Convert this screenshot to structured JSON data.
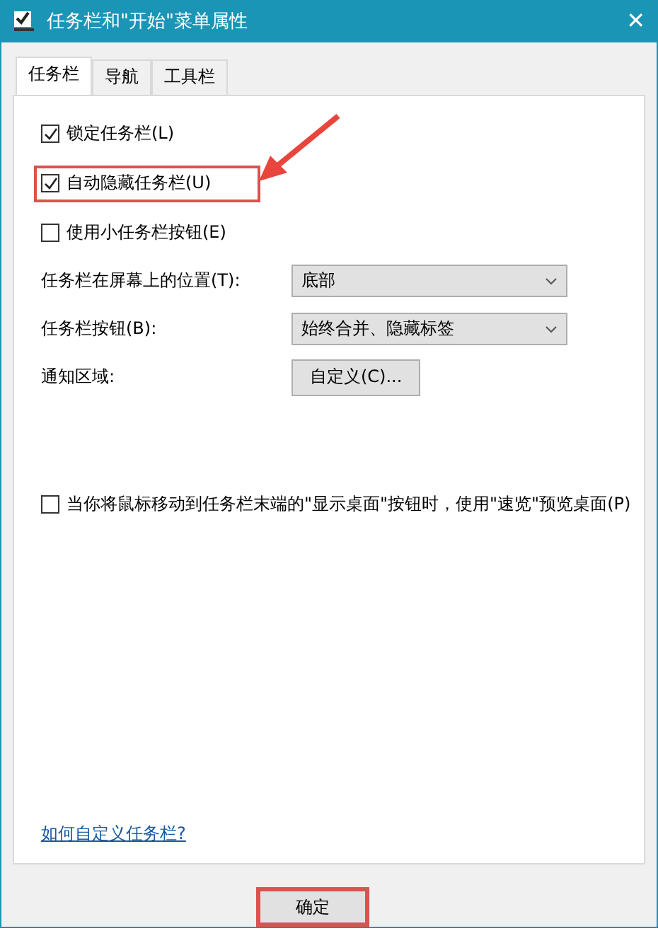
{
  "window": {
    "title": "任务栏和\"开始\"菜单属性",
    "close": "✕"
  },
  "tabs": [
    {
      "label": "任务栏",
      "selected": true
    },
    {
      "label": "导航",
      "selected": false
    },
    {
      "label": "工具栏",
      "selected": false
    }
  ],
  "options": [
    {
      "kind": "checkbox",
      "label": "锁定任务栏(L)",
      "checked": true,
      "highlighted": false
    },
    {
      "kind": "checkbox",
      "label": "自动隐藏任务栏(U)",
      "checked": true,
      "highlighted": true
    },
    {
      "kind": "checkbox",
      "label": "使用小任务栏按钮(E)",
      "checked": false,
      "highlighted": false
    },
    {
      "kind": "dropdown",
      "label": "任务栏在屏幕上的位置(T):",
      "value": "底部"
    },
    {
      "kind": "dropdown",
      "label": "任务栏按钮(B):",
      "value": "始终合并、隐藏标签"
    },
    {
      "kind": "button",
      "label": "通知区域:",
      "value": "自定义(C)..."
    }
  ],
  "peek": {
    "label": "当你将鼠标移动到任务栏末端的\"显示桌面\"按钮时，使用\"速览\"预览桌面(P)",
    "checked": false
  },
  "help_link": "如何自定义任务栏?",
  "buttons": [
    {
      "label": "确定",
      "highlighted": true
    }
  ]
}
